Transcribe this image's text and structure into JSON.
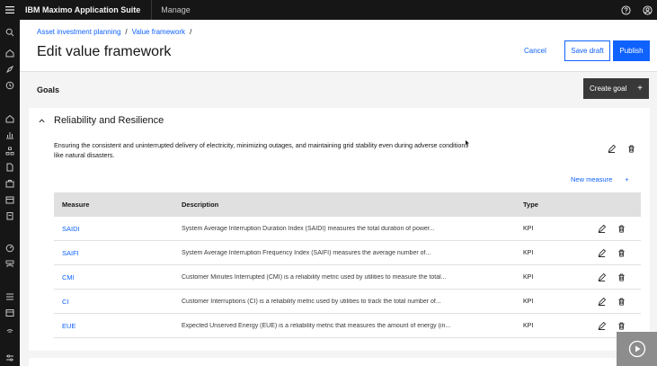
{
  "header": {
    "brand_bold": "IBM",
    "brand_rest": "Maximo Application Suite",
    "module": "Manage"
  },
  "breadcrumb": [
    {
      "label": "Asset investment planning"
    },
    {
      "label": "Value framework"
    }
  ],
  "breadcrumb_sep": "/",
  "page_title": "Edit value framework",
  "actions": {
    "cancel": "Cancel",
    "save_draft": "Save draft",
    "publish": "Publish"
  },
  "goals": {
    "label": "Goals",
    "create_goal": "Create goal",
    "create_goal_icon": "+"
  },
  "goal_card": {
    "title": "Reliability and Resilience",
    "description": "Ensuring the consistent and uninterrupted delivery of electricity, minimizing outages, and maintaining grid stability even during adverse conditions like natural disasters.",
    "new_measure": "New measure",
    "new_measure_icon": "+"
  },
  "table": {
    "columns": [
      "Measure",
      "Description",
      "Type"
    ],
    "rows": [
      {
        "measure": "SAIDI",
        "description": "System Average Interruption Duration Index (SAIDI) measures the total duration of power...",
        "type": "KPI"
      },
      {
        "measure": "SAIFI",
        "description": "System Average Interruption Frequency Index (SAIFI) measures the average number of...",
        "type": "KPI"
      },
      {
        "measure": "CMI",
        "description": "Customer Minutes Interrupted (CMI) is a reliability metric used by utilities to measure the total...",
        "type": "KPI"
      },
      {
        "measure": "CI",
        "description": "Customer Interruptions (CI) is a reliability metric used by utilities to track the total number of...",
        "type": "KPI"
      },
      {
        "measure": "EUE",
        "description": "Expected Unserved Energy (EUE) is a reliability metric that measures the amount of energy (in...",
        "type": "KPI"
      }
    ]
  },
  "icons": {
    "menu": "menu-icon",
    "help": "help-icon",
    "user": "user-icon",
    "edit": "edit-icon",
    "delete": "trash-icon",
    "chevron": "chevron-up-icon",
    "video": "play-icon"
  },
  "colors": {
    "primary": "#0f62fe",
    "header_bg": "#161616",
    "create_goal_bg": "#393939",
    "table_header_bg": "#e0e0e0",
    "page_bg": "#f4f4f4"
  }
}
